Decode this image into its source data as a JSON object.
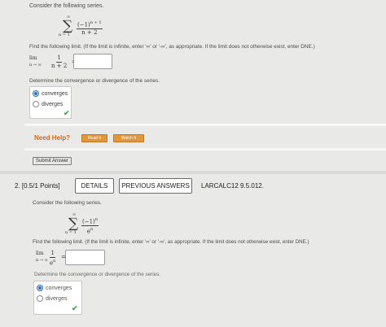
{
  "q1": {
    "prompt": "Consider the following series.",
    "series": {
      "upper": "∞",
      "lower": "n = 1",
      "numerator": "(−1)",
      "num_exp": "n + 1",
      "denominator": "n + 2"
    },
    "limit_instruction": "Find the following limit. (If the limit is infinite, enter '∞' or '-∞', as appropriate. If the limit does not otherwise exist, enter DNE.)",
    "limit_expr": {
      "lim": "lim",
      "sub": "n → ∞",
      "numerator": "1",
      "denominator": "n + 2",
      "equals": "="
    },
    "limit_answer": "",
    "convergence_prompt": "Determine the convergence or divergence of the series.",
    "options": [
      "converges",
      "diverges"
    ],
    "selected": "converges",
    "need_help": "Need Help?",
    "read_it": "Read It",
    "watch_it": "Watch It",
    "submit": "Submit Answer"
  },
  "q2": {
    "number": "2. [0.5/1 Points]",
    "details": "DETAILS",
    "previous_answers": "PREVIOUS ANSWERS",
    "code": "LARCALC12 9.5.012.",
    "prompt": "Consider the following series.",
    "series": {
      "upper": "∞",
      "lower": "n = 1",
      "numerator": "(−1)",
      "num_exp": "n",
      "denominator": "e",
      "den_exp": "n"
    },
    "limit_instruction": "Find the following limit. (If the limit is infinite, enter '∞' or '-∞', as appropriate. If the limit does not otherwise exist, enter DNE.)",
    "limit_expr": {
      "lim": "lim",
      "sub": "n → ∞",
      "numerator": "1",
      "denominator": "e",
      "den_exp": "n",
      "equals": "="
    },
    "limit_answer": "",
    "convergence_prompt": "Determine the convergence or divergence of the series.",
    "options": [
      "converges",
      "diverges"
    ],
    "selected": "converges"
  },
  "colors": {
    "need_help": "#d2691e",
    "accent_button": "#e0963b",
    "check": "#4aa34a",
    "radio_selected": "#2d6fb4"
  }
}
